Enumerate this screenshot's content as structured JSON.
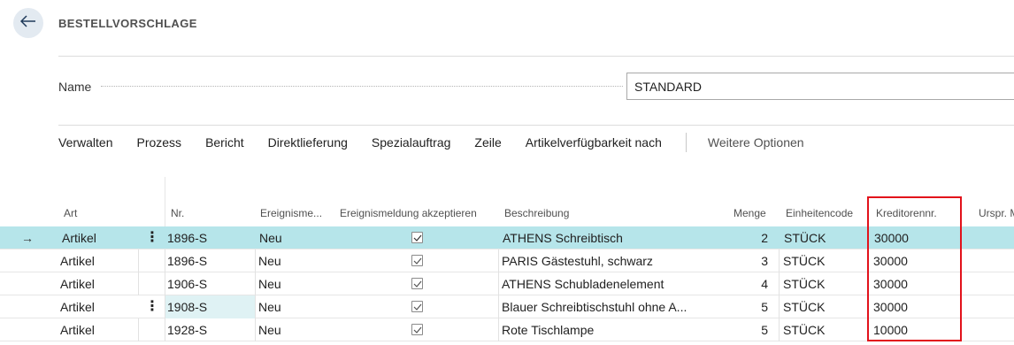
{
  "header": {
    "title": "BESTELLVORSCHLAGE",
    "back_icon": "arrow-left-icon"
  },
  "form": {
    "name_label": "Name",
    "name_value": "STANDARD"
  },
  "actions": [
    "Verwalten",
    "Prozess",
    "Bericht",
    "Direktlieferung",
    "Spezialauftrag",
    "Zeile",
    "Artikelverfügbarkeit nach"
  ],
  "more_options": "Weitere Optionen",
  "columns": {
    "art": "Art",
    "nr": "Nr.",
    "ereignis": "Ereignisme...",
    "akzept": "Ereignismeldung akzeptieren",
    "beschreibung": "Beschreibung",
    "menge": "Menge",
    "einheit": "Einheitencode",
    "kreditor": "Kreditorennr.",
    "urspr": "Urspr. M"
  },
  "rows": [
    {
      "art": "Artikel",
      "nr": "1896-S",
      "ereignis": "Neu",
      "akzept": true,
      "beschreibung": "ATHENS Schreibtisch",
      "menge": "2",
      "einheit": "STÜCK",
      "kreditor": "30000"
    },
    {
      "art": "Artikel",
      "nr": "1896-S",
      "ereignis": "Neu",
      "akzept": true,
      "beschreibung": "PARIS Gästestuhl, schwarz",
      "menge": "3",
      "einheit": "STÜCK",
      "kreditor": "30000"
    },
    {
      "art": "Artikel",
      "nr": "1906-S",
      "ereignis": "Neu",
      "akzept": true,
      "beschreibung": "ATHENS Schubladenelement",
      "menge": "4",
      "einheit": "STÜCK",
      "kreditor": "30000"
    },
    {
      "art": "Artikel",
      "nr": "1908-S",
      "ereignis": "Neu",
      "akzept": true,
      "beschreibung": "Blauer Schreibtischstuhl ohne A...",
      "menge": "5",
      "einheit": "STÜCK",
      "kreditor": "30000"
    },
    {
      "art": "Artikel",
      "nr": "1928-S",
      "ereignis": "Neu",
      "akzept": true,
      "beschreibung": "Rote Tischlampe",
      "menge": "5",
      "einheit": "STÜCK",
      "kreditor": "10000"
    }
  ],
  "colors": {
    "selected_row": "#b6e5ea",
    "focused_cell": "#dff2f4",
    "highlight_box": "#e2121b"
  }
}
